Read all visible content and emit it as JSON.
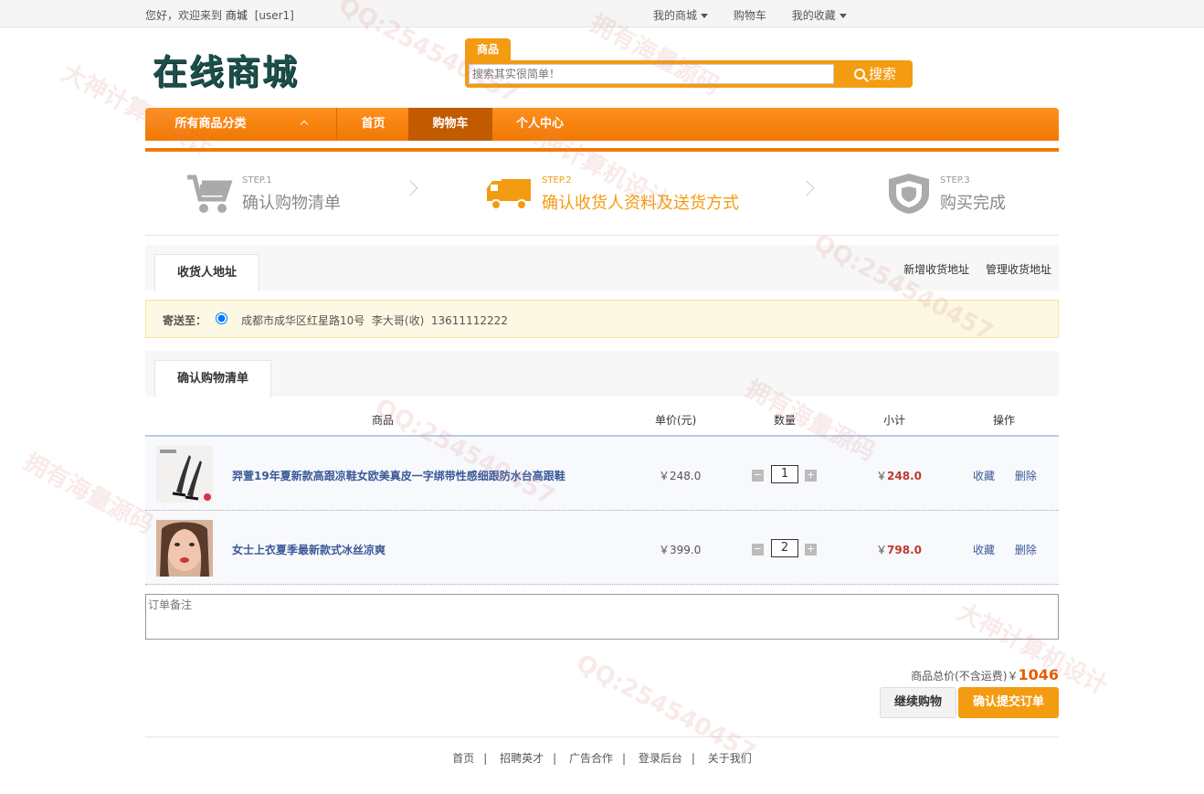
{
  "topbar": {
    "greeting": "您好，欢迎来到",
    "shop": "商城",
    "user": "[user1]",
    "links": [
      "我的商城",
      "购物车",
      "我的收藏"
    ]
  },
  "logo": "在线商城",
  "search": {
    "tab": "商品",
    "placeholder": "搜索其实很简单！",
    "button": "搜索"
  },
  "nav": {
    "categories": "所有商品分类",
    "home": "首页",
    "cart": "购物车",
    "user_center": "个人中心"
  },
  "steps": [
    {
      "num": "STEP.1",
      "title": "确认购物清单"
    },
    {
      "num": "STEP.2",
      "title": "确认收货人资料及送货方式"
    },
    {
      "num": "STEP.3",
      "title": "购买完成"
    }
  ],
  "address_section": {
    "tab": "收货人地址",
    "add_link": "新增收货地址",
    "manage_link": "管理收货地址",
    "label": "寄送至：",
    "address": "成都市成华区红星路10号  李大哥(收)  13611112222"
  },
  "cart_section": {
    "tab": "确认购物清单",
    "columns": {
      "product": "商品",
      "price": "单价(元)",
      "qty": "数量",
      "subtotal": "小计",
      "ops": "操作"
    },
    "items": [
      {
        "name": "羿萱19年夏新款高跟凉鞋女欧美真皮一字绑带性感细跟防水台高跟鞋",
        "price": "￥248.0",
        "qty": "1",
        "currency": "￥",
        "subtotal": "248.0"
      },
      {
        "name": "女士上衣夏季最新款式冰丝凉爽",
        "price": "￥399.0",
        "qty": "2",
        "currency": "￥",
        "subtotal": "798.0"
      }
    ],
    "fav": "收藏",
    "del": "删除"
  },
  "note": {
    "placeholder": "订单备注"
  },
  "total": {
    "label": "商品总价(不含运费)￥",
    "value": "1046"
  },
  "buttons": {
    "continue": "继续购物",
    "submit": "确认提交订单"
  },
  "footer": [
    "首页",
    "招聘英才",
    "广告合作",
    "登录后台",
    "关于我们"
  ],
  "watermarks": [
    "QQ:254540457",
    "大神计算机设计",
    "拥有海量源码"
  ]
}
